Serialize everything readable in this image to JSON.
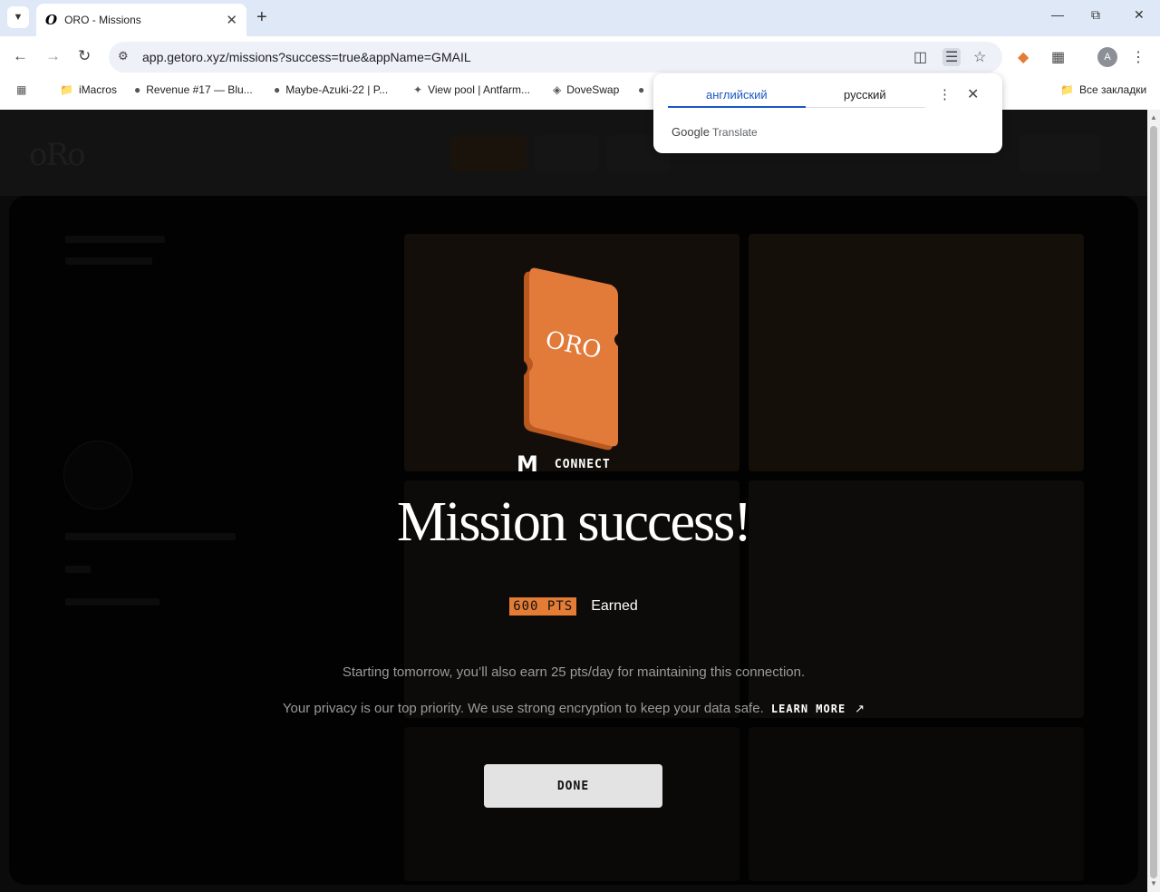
{
  "browser": {
    "tab_title": "ORO - Missions",
    "tab_favicon": "O",
    "url": "app.getoro.xyz/missions?success=true&appName=GMAIL",
    "avatar_letter": "A",
    "bookmarks": [
      {
        "label": "iMacros",
        "icon": "folder-icon"
      },
      {
        "label": "Revenue #17 — Blu...",
        "icon": "site-icon"
      },
      {
        "label": "Maybe-Azuki-22 | P...",
        "icon": "site-icon"
      },
      {
        "label": "View pool | Antfarm...",
        "icon": "site-icon"
      },
      {
        "label": "DoveSwap",
        "icon": "site-icon"
      }
    ],
    "all_bookmarks": "Все закладки"
  },
  "translate_popup": {
    "source_lang": "английский",
    "target_lang": "русский",
    "brand_google": "Google",
    "brand_translate": "Translate"
  },
  "modal": {
    "connect_label": "CONNECT",
    "headline": "Mission success!",
    "points_badge": "600 PTS",
    "earned_label": "Earned",
    "note_daily": "Starting tomorrow, you’ll also earn 25 pts/day for maintaining this connection.",
    "note_privacy": "Your privacy is our top priority. We use strong encryption to keep your data safe.",
    "learn_more": "LEARN MORE",
    "done_button": "DONE",
    "card_logo": "ORO"
  },
  "colors": {
    "accent_orange": "#e47c36",
    "translate_blue": "#1a57c2"
  }
}
